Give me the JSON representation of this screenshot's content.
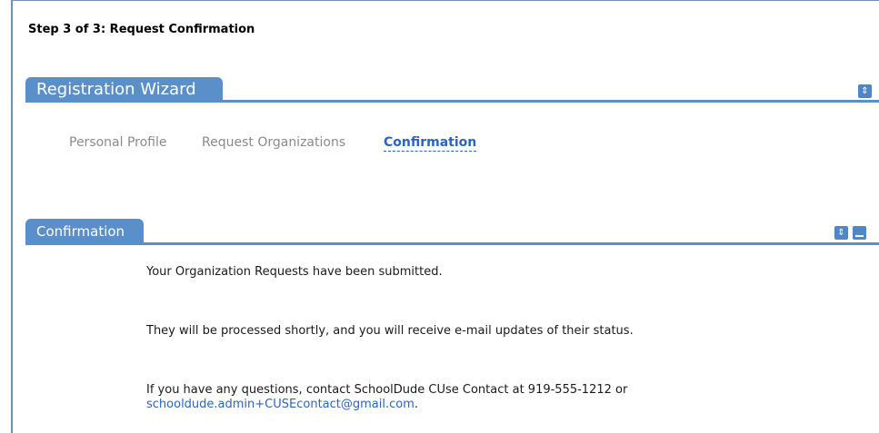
{
  "page": {
    "step_title": "Step 3 of 3: Request Confirmation"
  },
  "wizard": {
    "title": "Registration Wizard",
    "steps": [
      {
        "label": "Personal Profile"
      },
      {
        "label": "Request Organizations"
      },
      {
        "label": "Confirmation"
      }
    ],
    "active_step": "Confirmation"
  },
  "confirmation": {
    "title": "Confirmation",
    "message1": "Your Organization Requests have been submitted.",
    "message2": "They will be processed shortly, and you will receive e-mail updates of their status.",
    "message3_prefix": "If you have any questions, contact SchoolDude CUse Contact at 919-555-1212 or",
    "email": "schooldude.admin+CUSEcontact@gmail.com",
    "message3_suffix": "."
  },
  "icons": {
    "expand": "expand-collapse-icon",
    "minimize": "minimize-icon"
  },
  "colors": {
    "header_blue": "#5b8fc9",
    "link_blue": "#2a63c7",
    "inactive_gray": "#8a8a8a"
  }
}
